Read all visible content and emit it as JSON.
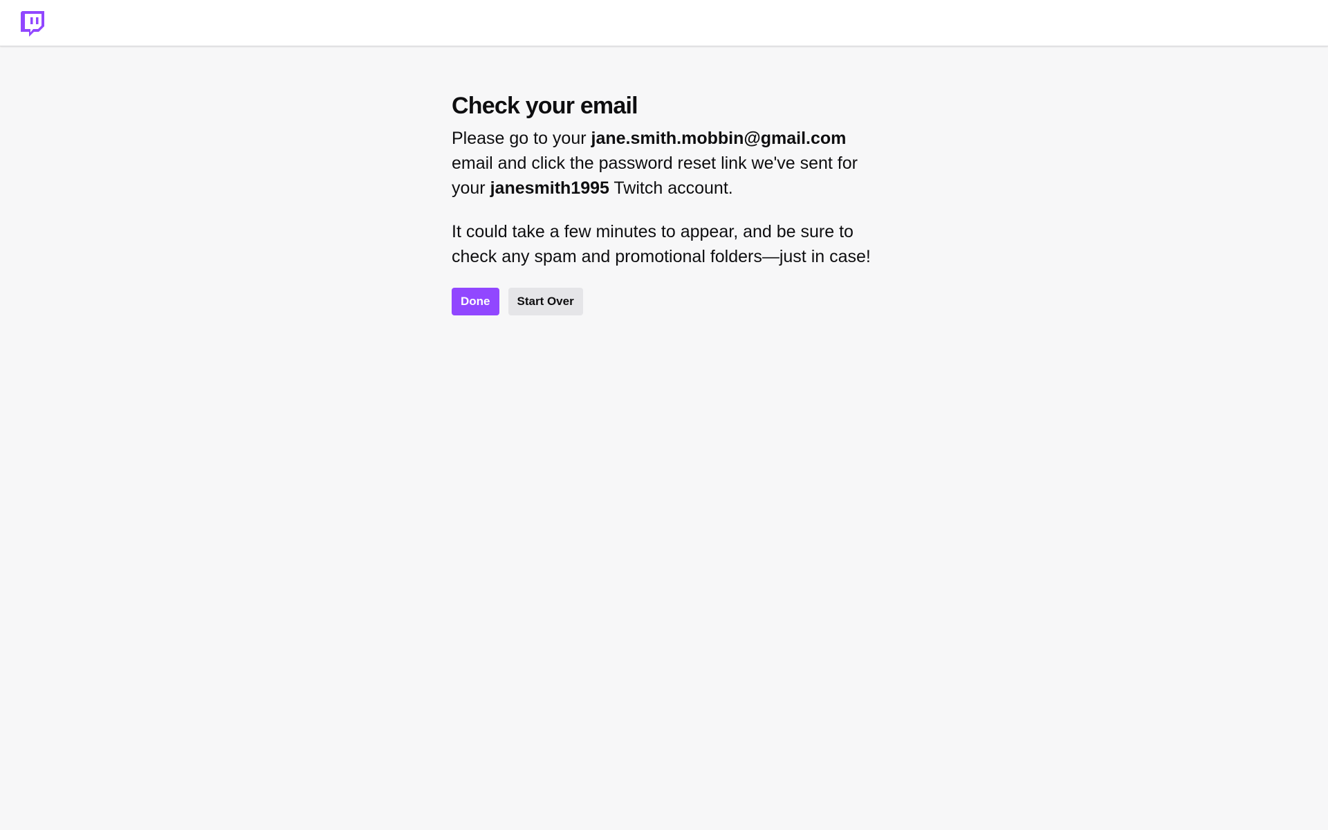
{
  "header": {
    "logo_icon": "twitch-glitch-logo-icon",
    "brand_color": "#9147ff"
  },
  "main": {
    "title": "Check your email",
    "paragraph1": {
      "before_email": "Please go to your ",
      "email": "jane.smith.mobbin@gmail.com",
      "middle": " email and click the password reset link we've sent for your ",
      "username": "janesmith1995",
      "after": " Twitch account."
    },
    "paragraph2": "It could take a few minutes to appear, and be sure to check any spam and promotional folders—just in case!",
    "buttons": {
      "done_label": "Done",
      "start_over_label": "Start Over"
    }
  },
  "colors": {
    "background": "#f7f7f8",
    "topbar": "#ffffff",
    "primary_button": "#9147ff",
    "secondary_button": "#e5e5e8",
    "text": "#0e0e10"
  }
}
